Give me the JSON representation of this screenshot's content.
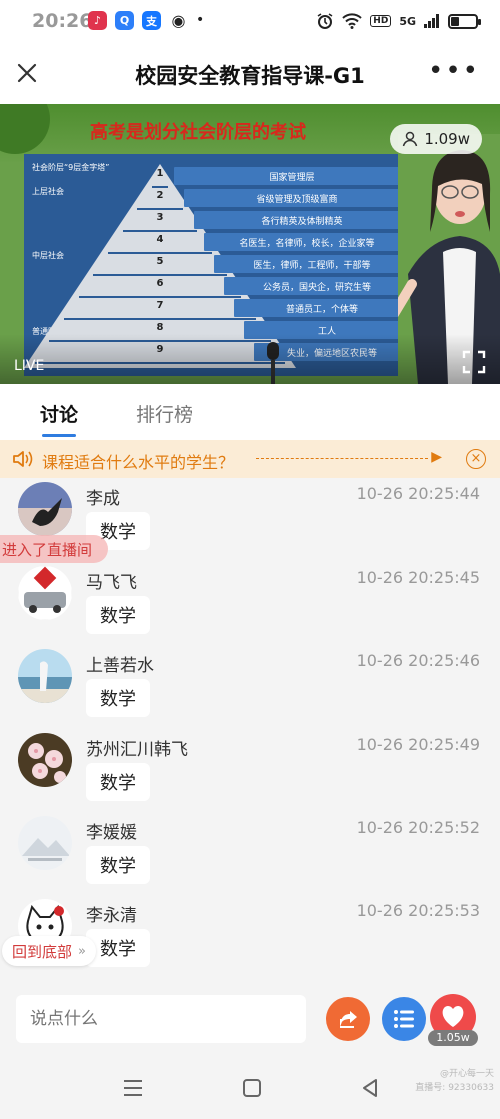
{
  "status_bar": {
    "time": "20:26",
    "apps": [
      {
        "name": "music-app-icon",
        "color": "#e0334d",
        "glyph": "♪"
      },
      {
        "name": "search-app-icon",
        "color": "#2d7ff9",
        "glyph": "Q"
      },
      {
        "name": "alipay-app-icon",
        "color": "#1677ff",
        "glyph": "支"
      },
      {
        "name": "wechat-app-icon",
        "color": "#2a2a2a",
        "glyph": "◉"
      }
    ],
    "dot": "•",
    "hd": "HD",
    "net": "5G"
  },
  "header": {
    "title": "校园安全教育指导课-G1",
    "more": "•••"
  },
  "video": {
    "slide_title": "高考是划分社会阶层的考试",
    "viewer_count": "1.09w",
    "live_label": "LIVE",
    "pyramid_caption": "社会阶层“9层金字塔”",
    "side_labels": [
      "上层社会",
      "中层社会",
      "普通阶层"
    ],
    "levels": [
      {
        "num": "1",
        "label": "国家管理层"
      },
      {
        "num": "2",
        "label": "省级管理及顶级富商"
      },
      {
        "num": "3",
        "label": "各行精英及体制精英"
      },
      {
        "num": "4",
        "label": "名医生，名律师，校长，企业家等"
      },
      {
        "num": "5",
        "label": "医生，律师，工程师，干部等"
      },
      {
        "num": "6",
        "label": "公务员，国央企，研究生等"
      },
      {
        "num": "7",
        "label": "普通员工，个体等"
      },
      {
        "num": "8",
        "label": "工人"
      },
      {
        "num": "9",
        "label": "失业，偏远地区农民等"
      }
    ]
  },
  "tabs": [
    {
      "label": "讨论",
      "active": true
    },
    {
      "label": "排行榜",
      "active": false
    }
  ],
  "notice": {
    "text": "课程适合什么水平的学生？",
    "play": "▶",
    "close": "×"
  },
  "messages": [
    {
      "name": "李成",
      "time": "10-26 20:25:44",
      "text": "数学",
      "avatar": "silhouette"
    },
    {
      "name": "马飞飞",
      "time": "10-26 20:25:45",
      "text": "数学",
      "avatar": "car"
    },
    {
      "name": "上善若水",
      "time": "10-26 20:25:46",
      "text": "数学",
      "avatar": "sea"
    },
    {
      "name": "苏州汇川韩飞",
      "time": "10-26 20:25:49",
      "text": "数学",
      "avatar": "blossom"
    },
    {
      "name": "李媛媛",
      "time": "10-26 20:25:52",
      "text": "数学",
      "avatar": "mountain"
    },
    {
      "name": "李永清",
      "time": "10-26 20:25:53",
      "text": "数学",
      "avatar": "cat"
    }
  ],
  "join_banner": "进入了直播间",
  "back_to_bottom": "回到底部",
  "input": {
    "placeholder": "说点什么"
  },
  "like_count": "1.05w",
  "watermark": {
    "line1": "@开心每一天",
    "line2": "直播号: 92330633"
  }
}
